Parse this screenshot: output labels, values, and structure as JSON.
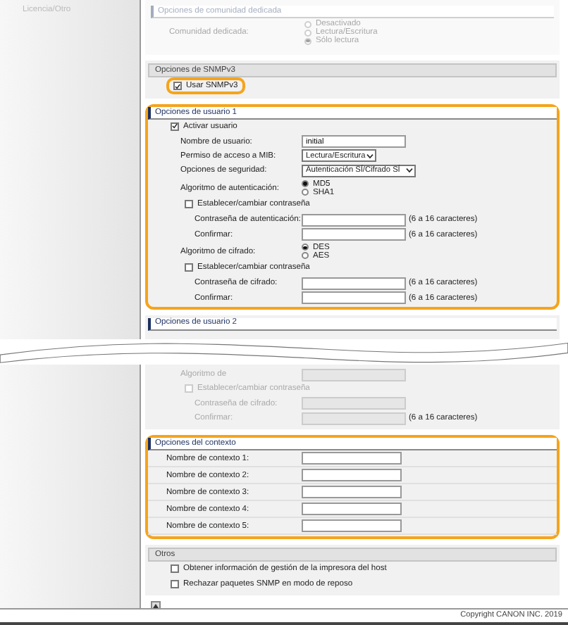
{
  "sidebar": {
    "items": [
      {
        "label": "Licencia/Otro"
      }
    ]
  },
  "dedicated_community": {
    "title": "Opciones de comunidad dedicada",
    "rows": [
      {
        "kind": "radio",
        "label": "Comunidad dedicada:",
        "options": [
          {
            "label": "Desactivado",
            "selected": false
          },
          {
            "label": "Lectura/Escritura",
            "selected": false
          },
          {
            "label": "Sólo lectura",
            "selected": true
          }
        ]
      }
    ]
  },
  "snmpv3": {
    "title": "Opciones de SNMPv3",
    "kind": "bar",
    "rows": [
      {
        "kind": "checkbox",
        "label": "Usar SNMPv3",
        "checked": true,
        "highlighted": true
      }
    ]
  },
  "user_1": {
    "title": "Opciones de usuario 1",
    "highlighted": true,
    "rows": [
      {
        "kind": "checkbox",
        "label": "Activar usuario",
        "checked": true,
        "children": [
          {
            "kind": "text",
            "label": "Nombre de usuario:",
            "value": "initial"
          },
          {
            "kind": "select",
            "label": "Permiso de acceso a MIB:",
            "value": "Lectura/Escritura"
          },
          {
            "kind": "select",
            "label": "Opciones de seguridad:",
            "value": "Autenticación SÍ/Cifrado SÍ"
          },
          {
            "kind": "radio",
            "label": "Algoritmo de autenticación:",
            "options": [
              {
                "label": "MD5",
                "selected": true
              },
              {
                "label": "SHA1",
                "selected": false
              }
            ]
          },
          {
            "kind": "checkbox",
            "label": "Establecer/cambiar contraseña",
            "checked": false,
            "children": [
              {
                "kind": "text",
                "label": "Contraseña de autenticación:",
                "note": "(6 a 16 caracteres)"
              },
              {
                "kind": "text",
                "label": "Confirmar:",
                "note": "(6 a 16 caracteres)"
              }
            ]
          },
          {
            "kind": "radio",
            "label": "Algoritmo de cifrado:",
            "options": [
              {
                "label": "DES",
                "selected": true
              },
              {
                "label": "AES",
                "selected": false
              }
            ]
          },
          {
            "kind": "checkbox",
            "label": "Establecer/cambiar contraseña",
            "checked": false,
            "children": [
              {
                "kind": "text",
                "label": "Contraseña de cifrado:",
                "note": "(6 a 16 caracteres)"
              },
              {
                "kind": "text",
                "label": "Confirmar:",
                "note": "(6 a 16 caracteres)"
              }
            ]
          }
        ]
      }
    ]
  },
  "user_2": {
    "title": "Opciones de usuario 2",
    "rows_after_break": [
      {
        "kind": "text",
        "label": "Algoritmo de",
        "disabled": true
      },
      {
        "kind": "checkbox",
        "label": "Establecer/cambiar contraseña",
        "checked": false,
        "disabled": true,
        "children": [
          {
            "kind": "text",
            "label": "Contraseña de cifrado:",
            "disabled": true
          },
          {
            "kind": "text",
            "label": "Confirmar:",
            "disabled": true,
            "note": "(6 a 16 caracteres)"
          }
        ]
      }
    ]
  },
  "context": {
    "title": "Opciones del contexto",
    "highlighted": true,
    "rows": [
      {
        "kind": "text",
        "label": "Nombre de contexto 1:"
      },
      {
        "kind": "text",
        "label": "Nombre de contexto 2:"
      },
      {
        "kind": "text",
        "label": "Nombre de contexto 3:"
      },
      {
        "kind": "text",
        "label": "Nombre de contexto 4:"
      },
      {
        "kind": "text",
        "label": "Nombre de contexto 5:"
      }
    ]
  },
  "others": {
    "title": "Otros",
    "kind": "bar",
    "rows": [
      {
        "kind": "checkbox",
        "label": "Obtener información de gestión de la impresora del host",
        "checked": false
      },
      {
        "kind": "checkbox",
        "label": "Rechazar paquetes SNMP en modo de reposo",
        "checked": false
      }
    ]
  },
  "footer": {
    "copyright": "Copyright CANON INC. 2019"
  }
}
